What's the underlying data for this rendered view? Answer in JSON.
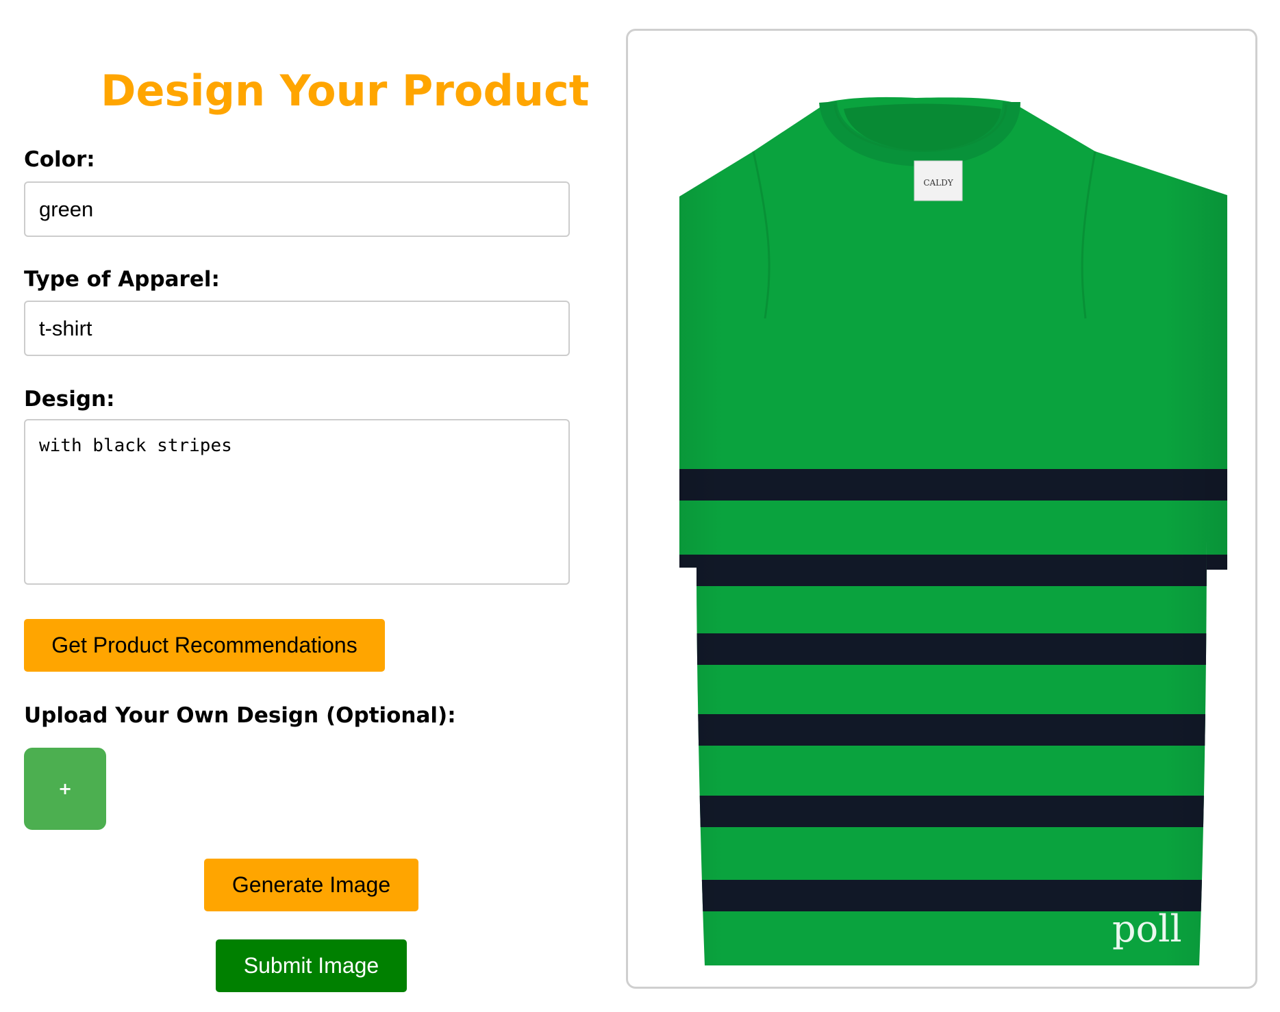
{
  "form": {
    "title": "Design Your Product",
    "color_label": "Color:",
    "color_value": "green",
    "apparel_label": "Type of Apparel:",
    "apparel_value": "t-shirt",
    "design_label": "Design:",
    "design_value": "with black stripes",
    "recommend_button": "Get Product Recommendations",
    "upload_label": "Upload Your Own Design (Optional):",
    "upload_button": "+",
    "generate_button": "Generate Image",
    "submit_button": "Submit Image"
  },
  "preview": {
    "watermark": "poll",
    "tag_text": "CALDY",
    "shirt_color": "#0aa33e",
    "stripe_color": "#111827"
  },
  "colors": {
    "accent_orange": "#ffa500",
    "upload_green": "#4caf50",
    "submit_green": "#008000"
  }
}
